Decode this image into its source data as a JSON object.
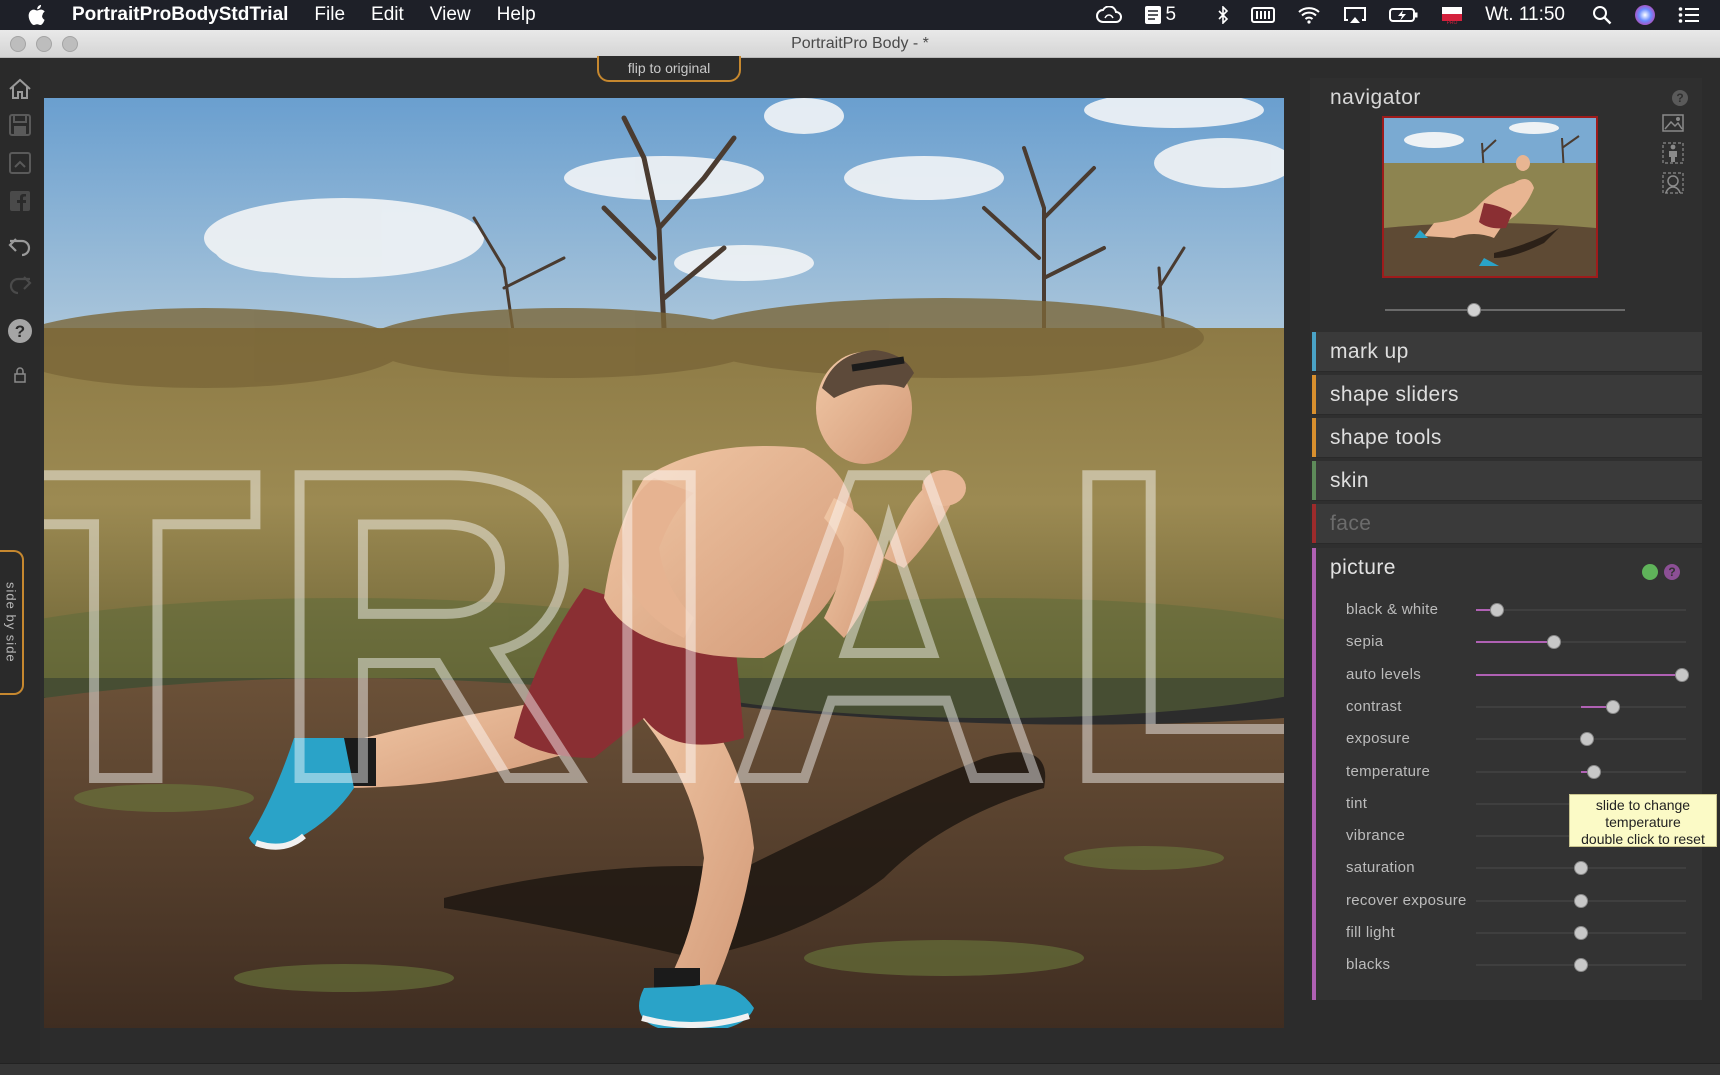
{
  "menubar": {
    "app_name": "PortraitProBodyStdTrial",
    "menus": [
      "File",
      "Edit",
      "View",
      "Help"
    ],
    "status": {
      "badge_count": "5",
      "clock": "Wt. 11:50"
    }
  },
  "window": {
    "title": "PortraitPro Body -  *"
  },
  "toolbar": {
    "flip_label": "flip to original",
    "side_by_side": "side by side"
  },
  "photo": {
    "watermark": "TRIAL"
  },
  "navigator": {
    "title": "navigator",
    "help": "?",
    "zoom_level": 0.37
  },
  "sections": [
    {
      "label": "mark up",
      "color": "#4aa3c7",
      "enabled": true
    },
    {
      "label": "shape sliders",
      "color": "#d9902e",
      "enabled": true
    },
    {
      "label": "shape tools",
      "color": "#d9902e",
      "enabled": true
    },
    {
      "label": "skin",
      "color": "#5e8b5a",
      "enabled": true
    },
    {
      "label": "face",
      "color": "#9d2b2b",
      "enabled": false
    }
  ],
  "picture": {
    "title": "picture",
    "help": "?",
    "accent": "#b061b4",
    "sliders": [
      {
        "label": "black & white",
        "value": 0.1
      },
      {
        "label": "sepia",
        "value": 0.37
      },
      {
        "label": "auto levels",
        "value": 0.98
      },
      {
        "label": "contrast",
        "value": 0.65
      },
      {
        "label": "exposure",
        "value": 0.53
      },
      {
        "label": "temperature",
        "value": 0.56
      },
      {
        "label": "tint",
        "value": 0.5
      },
      {
        "label": "vibrance",
        "value": 0.5
      },
      {
        "label": "saturation",
        "value": 0.5
      },
      {
        "label": "recover exposure",
        "value": 0.5
      },
      {
        "label": "fill light",
        "value": 0.5
      },
      {
        "label": "blacks",
        "value": 0.5
      }
    ]
  },
  "tooltip": {
    "line1": "slide to change",
    "line2": "temperature",
    "line3": "double click to reset"
  }
}
